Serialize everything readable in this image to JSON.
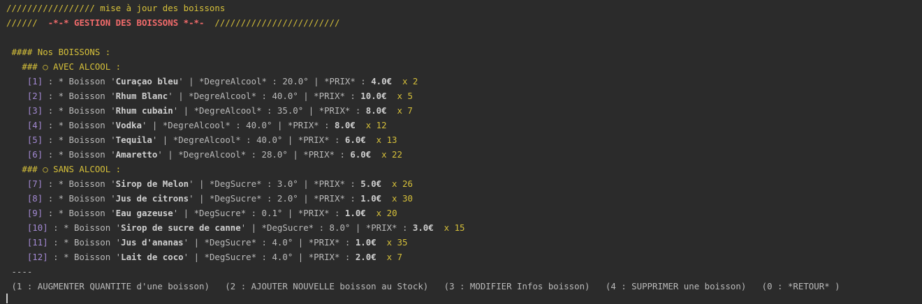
{
  "header": {
    "line1": "///////////////// mise à jour des boissons",
    "line2_left": "//////  ",
    "line2_title": "-*-* GESTION DES BOISSONS *-*-",
    "line2_right": "  ////////////////////////"
  },
  "section_title": " #### Nos BOISSONS :",
  "alcool": {
    "heading": "   ### ○ AVEC ALCOOL :",
    "items": [
      {
        "idx": "[1]",
        "pre": " : * Boisson '",
        "name": "Curaçao bleu",
        "mid": "' | *DegreAlcool* : 20.0° | *PRIX* : ",
        "price": "4.0€",
        "qty": "  x 2"
      },
      {
        "idx": "[2]",
        "pre": " : * Boisson '",
        "name": "Rhum Blanc",
        "mid": "' | *DegreAlcool* : 40.0° | *PRIX* : ",
        "price": "10.0€",
        "qty": "  x 5"
      },
      {
        "idx": "[3]",
        "pre": " : * Boisson '",
        "name": "Rhum cubain",
        "mid": "' | *DegreAlcool* : 35.0° | *PRIX* : ",
        "price": "8.0€",
        "qty": "  x 7"
      },
      {
        "idx": "[4]",
        "pre": " : * Boisson '",
        "name": "Vodka",
        "mid": "' | *DegreAlcool* : 40.0° | *PRIX* : ",
        "price": "8.0€",
        "qty": "  x 12"
      },
      {
        "idx": "[5]",
        "pre": " : * Boisson '",
        "name": "Tequila",
        "mid": "' | *DegreAlcool* : 40.0° | *PRIX* : ",
        "price": "6.0€",
        "qty": "  x 13"
      },
      {
        "idx": "[6]",
        "pre": " : * Boisson '",
        "name": "Amaretto",
        "mid": "' | *DegreAlcool* : 28.0° | *PRIX* : ",
        "price": "6.0€",
        "qty": "  x 22"
      }
    ]
  },
  "sans_alcool": {
    "heading": "   ### ○ SANS ALCOOL :",
    "items": [
      {
        "idx": "[7]",
        "pre": " : * Boisson '",
        "name": "Sirop de Melon",
        "mid": "' | *DegSucre* : 3.0° | *PRIX* : ",
        "price": "5.0€",
        "qty": "  x 26"
      },
      {
        "idx": "[8]",
        "pre": " : * Boisson '",
        "name": "Jus de citrons",
        "mid": "' | *DegSucre* : 2.0° | *PRIX* : ",
        "price": "1.0€",
        "qty": "  x 30"
      },
      {
        "idx": "[9]",
        "pre": " : * Boisson '",
        "name": "Eau gazeuse",
        "mid": "' | *DegSucre* : 0.1° | *PRIX* : ",
        "price": "1.0€",
        "qty": "  x 20"
      },
      {
        "idx": "[10]",
        "pre": " : * Boisson '",
        "name": "Sirop de sucre de canne",
        "mid": "' | *DegSucre* : 8.0° | *PRIX* : ",
        "price": "3.0€",
        "qty": "  x 15"
      },
      {
        "idx": "[11]",
        "pre": " : * Boisson '",
        "name": "Jus d'ananas",
        "mid": "' | *DegSucre* : 4.0° | *PRIX* : ",
        "price": "1.0€",
        "qty": "  x 35"
      },
      {
        "idx": "[12]",
        "pre": " : * Boisson '",
        "name": "Lait de coco",
        "mid": "' | *DegSucre* : 4.0° | *PRIX* : ",
        "price": "2.0€",
        "qty": "  x 7"
      }
    ]
  },
  "separator": " ----",
  "menu": " (1 : AUGMENTER QUANTITE d'une boisson)   (2 : AJOUTER NOUVELLE boisson au Stock)   (3 : MODIFIER Infos boisson)   (4 : SUPPRIMER une boisson)   (0 : *RETOUR* )",
  "colors": {
    "background": "#2b2b2b",
    "text": "#bbbbbb",
    "yellow": "#d6c03a",
    "red": "#f26b6b",
    "index": "#a48ad4"
  }
}
